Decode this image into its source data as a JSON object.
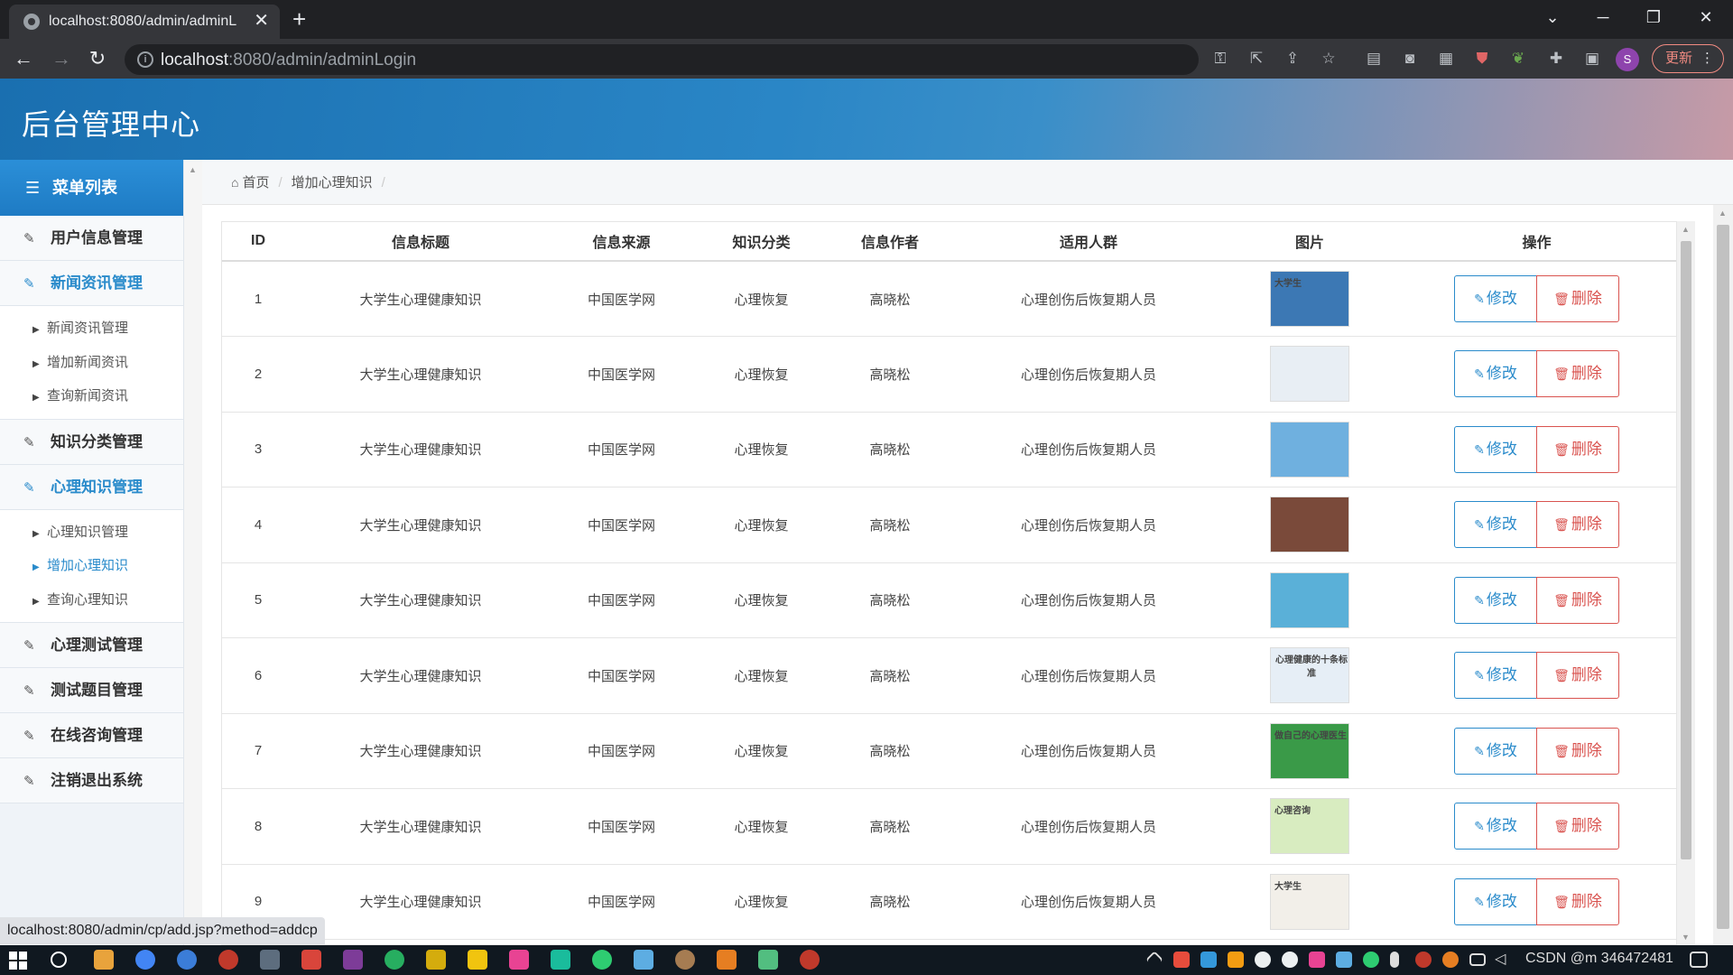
{
  "browser": {
    "tab_title": "localhost:8080/admin/adminL",
    "tab_close": "✕",
    "new_tab": "+",
    "url_host": "localhost",
    "url_path": ":8080/admin/adminLogin",
    "update_label": "更新",
    "profile_initial": "S",
    "status_link": "localhost:8080/admin/cp/add.jsp?method=addcp"
  },
  "header": {
    "site_title": "后台管理中心"
  },
  "sidebar": {
    "menu_title": "菜单列表",
    "items": [
      {
        "label": "用户信息管理",
        "active": false
      },
      {
        "label": "新闻资讯管理",
        "active": true,
        "sub": [
          "新闻资讯管理",
          "增加新闻资讯",
          "查询新闻资讯"
        ]
      },
      {
        "label": "知识分类管理",
        "active": false
      },
      {
        "label": "心理知识管理",
        "active": true,
        "sub": [
          "心理知识管理",
          "增加心理知识",
          "查询心理知识"
        ],
        "active_sub": 1
      },
      {
        "label": "心理测试管理",
        "active": false
      },
      {
        "label": "测试题目管理",
        "active": false
      },
      {
        "label": "在线咨询管理",
        "active": false
      },
      {
        "label": "注销退出系统",
        "active": false
      }
    ]
  },
  "breadcrumb": {
    "home": "首页",
    "current": "增加心理知识",
    "sep": "/"
  },
  "table": {
    "headers": [
      "ID",
      "信息标题",
      "信息来源",
      "知识分类",
      "信息作者",
      "适用人群",
      "图片",
      "操作"
    ],
    "edit_label": "修改",
    "delete_label": "删除",
    "rows": [
      {
        "id": "1",
        "title": "大学生心理健康知识",
        "source": "中国医学网",
        "category": "心理恢复",
        "author": "高晓松",
        "audience": "心理创伤后恢复期人员",
        "thumb_text": "大学生",
        "thumb_color": "#3c78b4"
      },
      {
        "id": "2",
        "title": "大学生心理健康知识",
        "source": "中国医学网",
        "category": "心理恢复",
        "author": "高晓松",
        "audience": "心理创伤后恢复期人员",
        "thumb_text": "",
        "thumb_color": "#e8eef4"
      },
      {
        "id": "3",
        "title": "大学生心理健康知识",
        "source": "中国医学网",
        "category": "心理恢复",
        "author": "高晓松",
        "audience": "心理创伤后恢复期人员",
        "thumb_text": "",
        "thumb_color": "#6fb0df"
      },
      {
        "id": "4",
        "title": "大学生心理健康知识",
        "source": "中国医学网",
        "category": "心理恢复",
        "author": "高晓松",
        "audience": "心理创伤后恢复期人员",
        "thumb_text": "",
        "thumb_color": "#7a4a3a"
      },
      {
        "id": "5",
        "title": "大学生心理健康知识",
        "source": "中国医学网",
        "category": "心理恢复",
        "author": "高晓松",
        "audience": "心理创伤后恢复期人员",
        "thumb_text": "",
        "thumb_color": "#5ab0d8"
      },
      {
        "id": "6",
        "title": "大学生心理健康知识",
        "source": "中国医学网",
        "category": "心理恢复",
        "author": "高晓松",
        "audience": "心理创伤后恢复期人员",
        "thumb_text": "心理健康的十条标准",
        "thumb_color": "#e6eef6"
      },
      {
        "id": "7",
        "title": "大学生心理健康知识",
        "source": "中国医学网",
        "category": "心理恢复",
        "author": "高晓松",
        "audience": "心理创伤后恢复期人员",
        "thumb_text": "做自己的心理医生",
        "thumb_color": "#3a9a48"
      },
      {
        "id": "8",
        "title": "大学生心理健康知识",
        "source": "中国医学网",
        "category": "心理恢复",
        "author": "高晓松",
        "audience": "心理创伤后恢复期人员",
        "thumb_text": "心理咨询",
        "thumb_color": "#d8ecc0"
      },
      {
        "id": "9",
        "title": "大学生心理健康知识",
        "source": "中国医学网",
        "category": "心理恢复",
        "author": "高晓松",
        "audience": "心理创伤后恢复期人员",
        "thumb_text": "大学生",
        "thumb_color": "#f2efe9"
      }
    ]
  },
  "taskbar": {
    "tray_text": "CSDN @m 346472481"
  },
  "colors": {
    "accent": "#2a8bcb",
    "danger": "#d9534f",
    "header_start": "#1a6fb0",
    "header_end": "#c79aa6"
  }
}
